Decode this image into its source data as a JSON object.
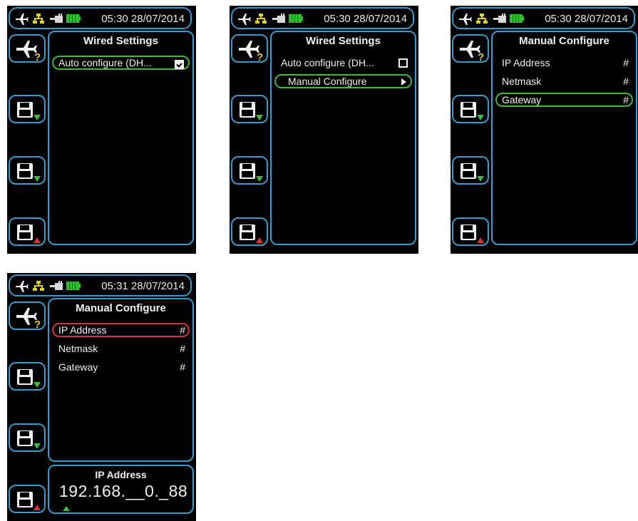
{
  "colors": {
    "frame_blue": "#2f9ed1",
    "select_green": "#3dbb3a",
    "select_red": "#d83030",
    "icon_yellow": "#e6d31c",
    "text": "#f0f0f0"
  },
  "icons": {
    "status": [
      "plane-icon",
      "network-icon",
      "power-plug-icon",
      "battery-icon"
    ],
    "side_buttons": [
      "airplane-help-icon",
      "save-down-icon",
      "save-down-icon",
      "save-up-icon"
    ]
  },
  "screens": [
    {
      "time": "05:30 28/07/2014",
      "title": "Wired Settings",
      "rows": [
        {
          "label": "Auto configure (DH...",
          "checkbox": "checked",
          "highlight": "green"
        }
      ]
    },
    {
      "time": "05:30 28/07/2014",
      "title": "Wired Settings",
      "rows": [
        {
          "label": "Auto configure (DH...",
          "checkbox": "unchecked"
        },
        {
          "label": "Manual Configure",
          "arrow": true,
          "highlight": "green"
        }
      ]
    },
    {
      "time": "05:30 28/07/2014",
      "title": "Manual Configure",
      "rows": [
        {
          "label": "IP Address",
          "value": "#"
        },
        {
          "label": "Netmask",
          "value": "#"
        },
        {
          "label": "Gateway",
          "value": "#",
          "highlight": "green"
        }
      ]
    },
    {
      "time": "05:31 28/07/2014",
      "title": "Manual Configure",
      "rows": [
        {
          "label": "IP Address",
          "value": "#",
          "highlight": "red"
        },
        {
          "label": "Netmask",
          "value": "#"
        },
        {
          "label": "Gateway",
          "value": "#"
        }
      ],
      "editor": {
        "title": "IP Address",
        "value": "192.168.__0._88"
      }
    }
  ]
}
